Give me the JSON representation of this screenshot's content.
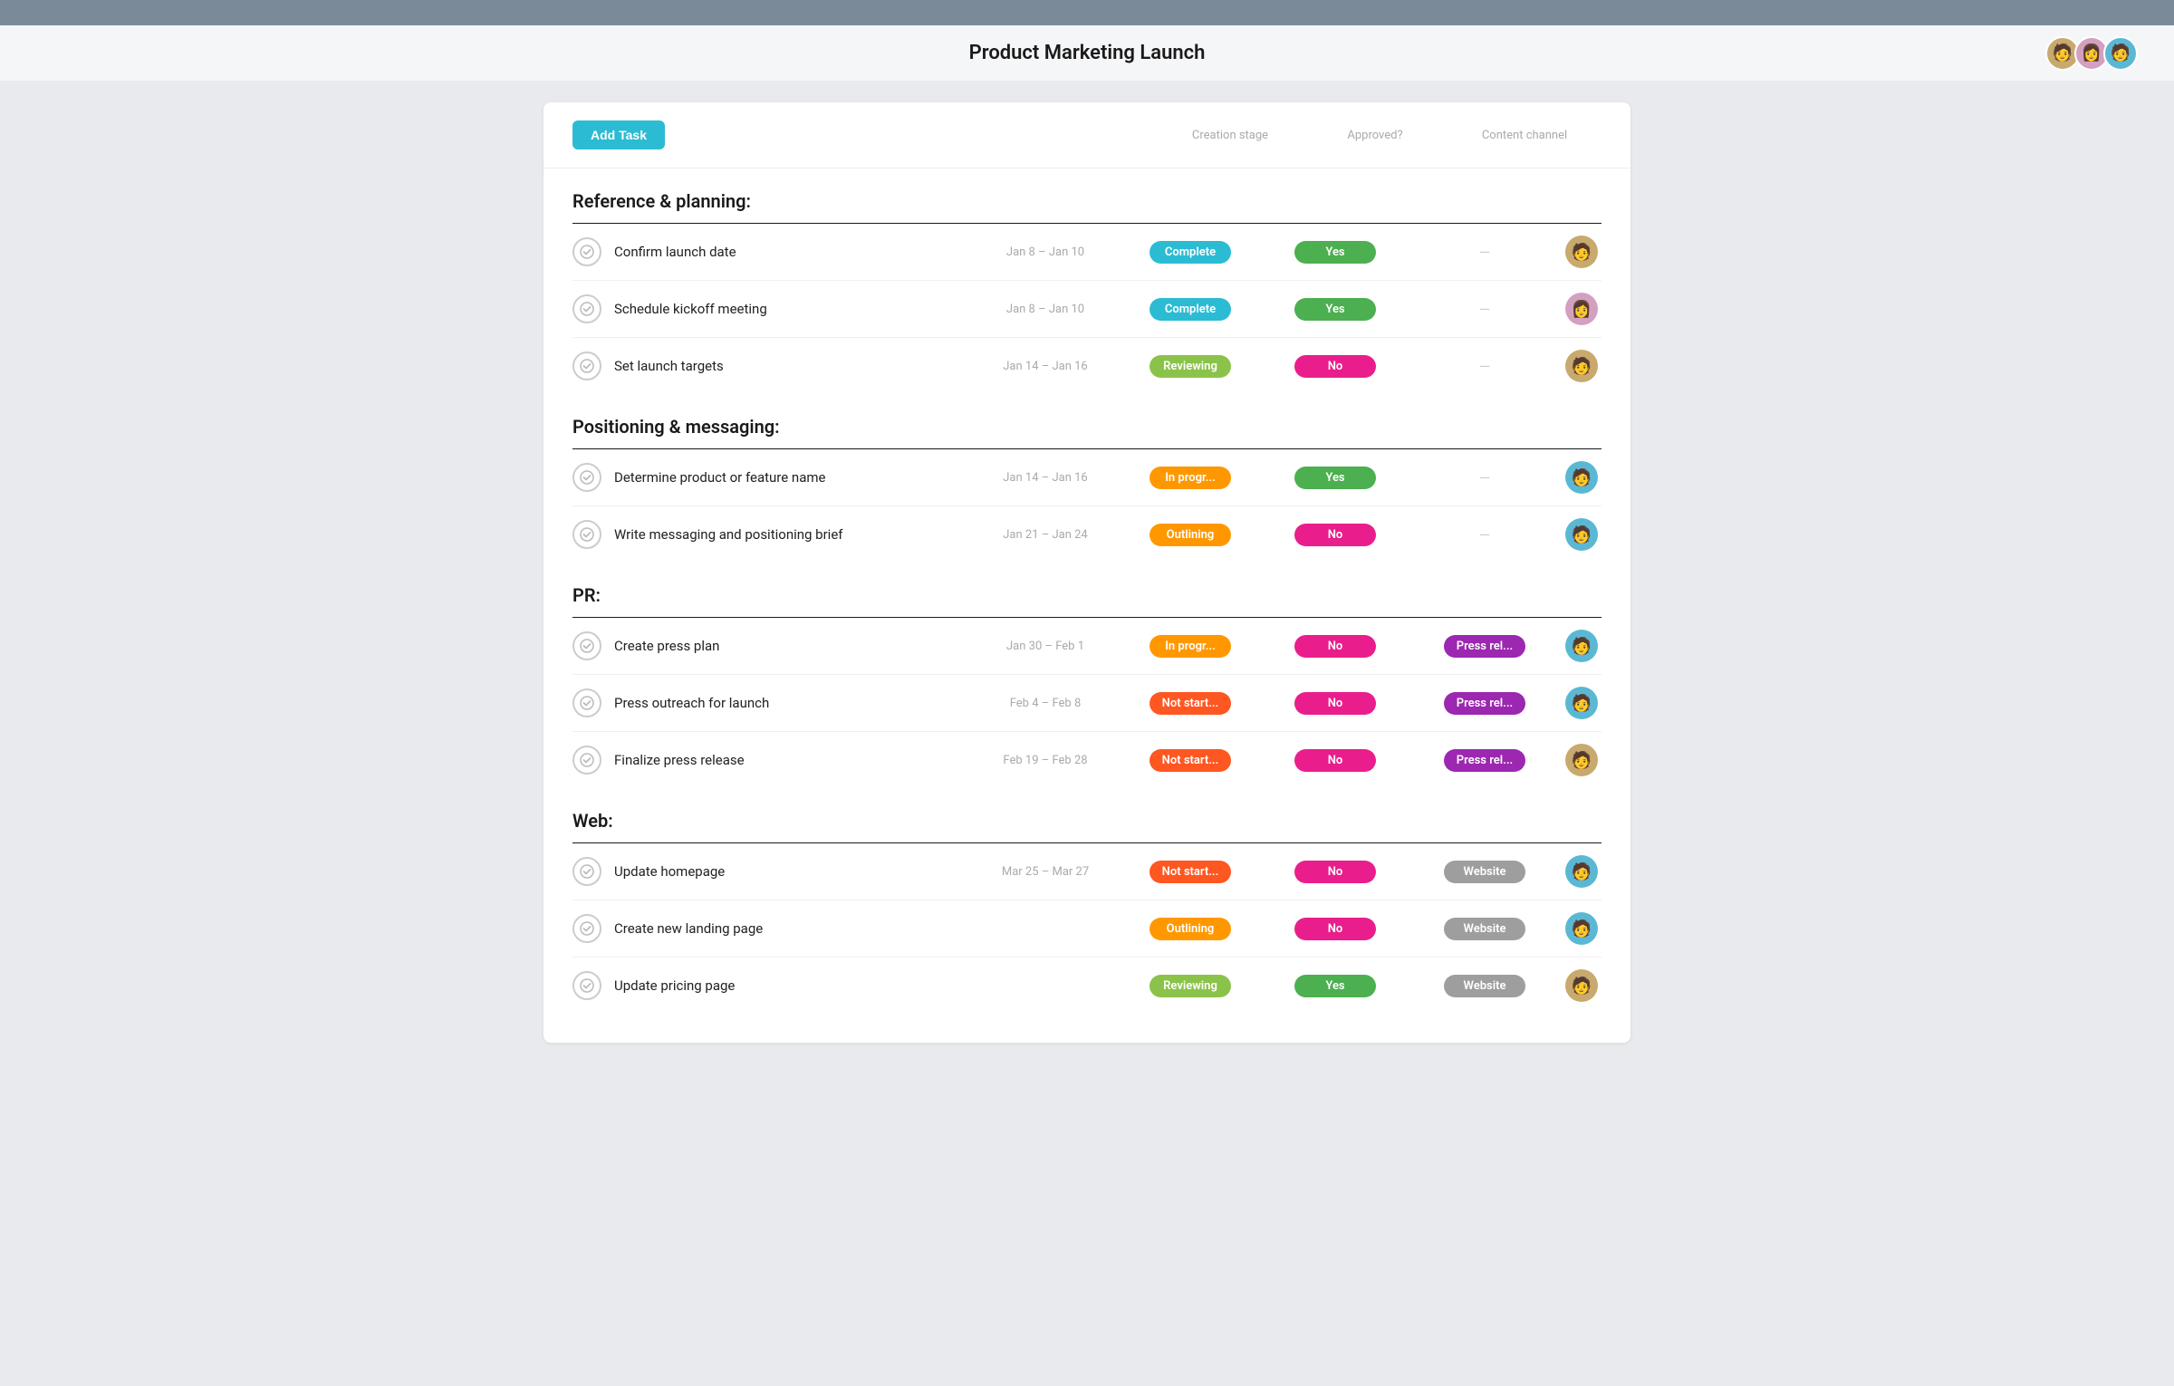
{
  "topbar": {},
  "header": {
    "title": "Product Marketing Launch",
    "avatars": [
      {
        "emoji": "🧑",
        "bg": "#c8a96e"
      },
      {
        "emoji": "👩",
        "bg": "#d4a0c0"
      },
      {
        "emoji": "🧑",
        "bg": "#5bb8d4"
      }
    ]
  },
  "toolbar": {
    "add_task_label": "Add Task",
    "col_headers": [
      "Creation stage",
      "Approved?",
      "Content channel"
    ]
  },
  "sections": [
    {
      "title": "Reference & planning:",
      "tasks": [
        {
          "name": "Confirm launch date",
          "date": "Jan 8 – Jan 10",
          "stage": "Complete",
          "stage_class": "badge-complete",
          "approved": "Yes",
          "approved_class": "badge-yes",
          "channel": "—",
          "channel_class": "",
          "avatar_emoji": "🧑",
          "avatar_bg": "#c8a96e"
        },
        {
          "name": "Schedule kickoff meeting",
          "date": "Jan 8 – Jan 10",
          "stage": "Complete",
          "stage_class": "badge-complete",
          "approved": "Yes",
          "approved_class": "badge-yes",
          "channel": "—",
          "channel_class": "",
          "avatar_emoji": "👩",
          "avatar_bg": "#d4a0c0"
        },
        {
          "name": "Set launch targets",
          "date": "Jan 14 – Jan 16",
          "stage": "Reviewing",
          "stage_class": "badge-reviewing",
          "approved": "No",
          "approved_class": "badge-no",
          "channel": "—",
          "channel_class": "",
          "avatar_emoji": "🧑",
          "avatar_bg": "#c8a96e"
        }
      ]
    },
    {
      "title": "Positioning & messaging:",
      "tasks": [
        {
          "name": "Determine product or feature name",
          "date": "Jan 14 – Jan 16",
          "stage": "In progr...",
          "stage_class": "badge-inprogress",
          "approved": "Yes",
          "approved_class": "badge-yes",
          "channel": "—",
          "channel_class": "",
          "avatar_emoji": "🧑",
          "avatar_bg": "#5bb8d4"
        },
        {
          "name": "Write messaging and positioning brief",
          "date": "Jan 21 – Jan 24",
          "stage": "Outlining",
          "stage_class": "badge-outlining",
          "approved": "No",
          "approved_class": "badge-no",
          "channel": "—",
          "channel_class": "",
          "avatar_emoji": "🧑",
          "avatar_bg": "#5bb8d4"
        }
      ]
    },
    {
      "title": "PR:",
      "tasks": [
        {
          "name": "Create press plan",
          "date": "Jan 30 – Feb 1",
          "stage": "In progr...",
          "stage_class": "badge-inprogress",
          "approved": "No",
          "approved_class": "badge-no",
          "channel": "Press rel...",
          "channel_class": "badge-pressrel",
          "avatar_emoji": "🧑",
          "avatar_bg": "#5bb8d4"
        },
        {
          "name": "Press outreach for launch",
          "date": "Feb 4 – Feb 8",
          "stage": "Not start...",
          "stage_class": "badge-notstart",
          "approved": "No",
          "approved_class": "badge-no",
          "channel": "Press rel...",
          "channel_class": "badge-pressrel",
          "avatar_emoji": "🧑",
          "avatar_bg": "#5bb8d4"
        },
        {
          "name": "Finalize press release",
          "date": "Feb 19 – Feb 28",
          "stage": "Not start...",
          "stage_class": "badge-notstart",
          "approved": "No",
          "approved_class": "badge-no",
          "channel": "Press rel...",
          "channel_class": "badge-pressrel",
          "avatar_emoji": "🧑",
          "avatar_bg": "#c8a96e"
        }
      ]
    },
    {
      "title": "Web:",
      "tasks": [
        {
          "name": "Update homepage",
          "date": "Mar 25 – Mar 27",
          "stage": "Not start...",
          "stage_class": "badge-notstart",
          "approved": "No",
          "approved_class": "badge-no",
          "channel": "Website",
          "channel_class": "badge-website",
          "avatar_emoji": "🧑",
          "avatar_bg": "#5bb8d4"
        },
        {
          "name": "Create new landing page",
          "date": "",
          "stage": "Outlining",
          "stage_class": "badge-outlining",
          "approved": "No",
          "approved_class": "badge-no",
          "channel": "Website",
          "channel_class": "badge-website",
          "avatar_emoji": "🧑",
          "avatar_bg": "#5bb8d4"
        },
        {
          "name": "Update pricing page",
          "date": "",
          "stage": "Reviewing",
          "stage_class": "badge-reviewing",
          "approved": "Yes",
          "approved_class": "badge-yes",
          "channel": "Website",
          "channel_class": "badge-website",
          "avatar_emoji": "🧑",
          "avatar_bg": "#c8a96e"
        }
      ]
    }
  ]
}
